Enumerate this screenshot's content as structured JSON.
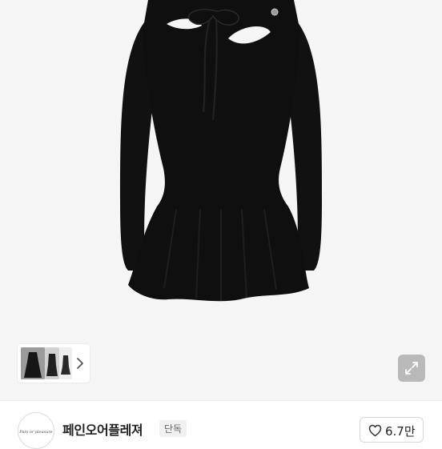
{
  "colors": {
    "background": "#f5f5f5",
    "dress": "#0f0f0f",
    "badge_bg": "#f1f1f1",
    "button_border": "#d6d6d6",
    "expand_button_bg": "#b9b9b9"
  },
  "gallery": {
    "main_image_subject": "black long-sleeve flared mini dress with cutout and tie neckline",
    "thumbnail_strip": {
      "next_icon": "chevron-right-icon"
    },
    "expand_icon": "expand-arrows-icon"
  },
  "seller": {
    "logo_icon": "brand-logo",
    "logo_text": "Pain or pleasure",
    "name": "페인오어플레져",
    "badge": "단독"
  },
  "like": {
    "icon": "heart-outline-icon",
    "count": "6.7만"
  }
}
